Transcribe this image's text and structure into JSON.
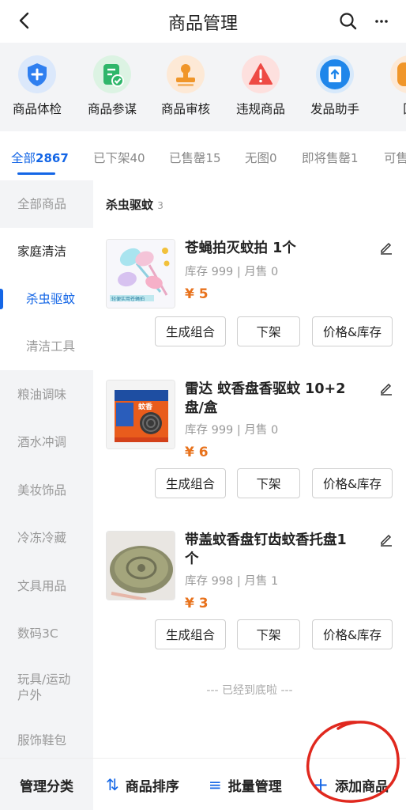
{
  "header": {
    "title": "商品管理"
  },
  "shortcuts": [
    {
      "label": "商品体检",
      "icon": "shield-plus-icon",
      "bg": "#dbe8fb",
      "color": "#2f7ff0"
    },
    {
      "label": "商品参谋",
      "icon": "check-document-icon",
      "bg": "#dcf3e3",
      "color": "#2fb66a"
    },
    {
      "label": "商品审核",
      "icon": "stamp-icon",
      "bg": "#fde9d6",
      "color": "#f0962a"
    },
    {
      "label": "违规商品",
      "icon": "warning-triangle-icon",
      "bg": "#fde0de",
      "color": "#ee4a44"
    },
    {
      "label": "发品助手",
      "icon": "upload-book-icon",
      "bg": "#d7e9fb",
      "color": "#1f86ea"
    },
    {
      "label": "回",
      "icon": "partial-icon",
      "bg": "#fde9d6",
      "color": "#f0962a"
    }
  ],
  "tabs": [
    {
      "label": "全部",
      "count": "2867",
      "active": true
    },
    {
      "label": "已下架",
      "count": "40"
    },
    {
      "label": "已售罄",
      "count": "15"
    },
    {
      "label": "无图",
      "count": "0"
    },
    {
      "label": "即将售罄",
      "count": "1"
    },
    {
      "label": "可售",
      "count": ""
    }
  ],
  "leftnav": [
    "全部商品",
    "家庭清洁",
    "杀虫驱蚊",
    "清洁工具",
    "粮油调味",
    "酒水冲调",
    "美妆饰品",
    "冷冻冷藏",
    "文具用品",
    "数码3C",
    "玩具/运动户外",
    "服饰鞋包"
  ],
  "section": {
    "title": "杀虫驱蚊",
    "count": "3"
  },
  "products": [
    {
      "name": "苍蝇拍灭蚊拍 1个",
      "stock": "库存 999",
      "sold": "月售 0",
      "price": "5",
      "thumb_caption": "轻便实用苍蝇拍"
    },
    {
      "name": "雷达 蚊香盘香驱蚊 10+2盘/盒",
      "stock": "库存 999",
      "sold": "月售 0",
      "price": "6",
      "thumb_caption": "蚊香"
    },
    {
      "name": "带盖蚊香盘钉齿蚊香托盘1个",
      "stock": "库存 998",
      "sold": "月售 1",
      "price": "3",
      "thumb_caption": ""
    }
  ],
  "product_buttons": {
    "combo": "生成组合",
    "off_shelf": "下架",
    "price_stock": "价格&库存"
  },
  "currency": "¥",
  "bottom_note": "--- 已经到底啦 ---",
  "bottombar": {
    "manage_category": "管理分类",
    "sort": "商品排序",
    "batch": "批量管理",
    "add": "添加商品"
  },
  "colors": {
    "accent": "#1466e6",
    "price": "#e8721c",
    "annotation": "#e0281e"
  }
}
